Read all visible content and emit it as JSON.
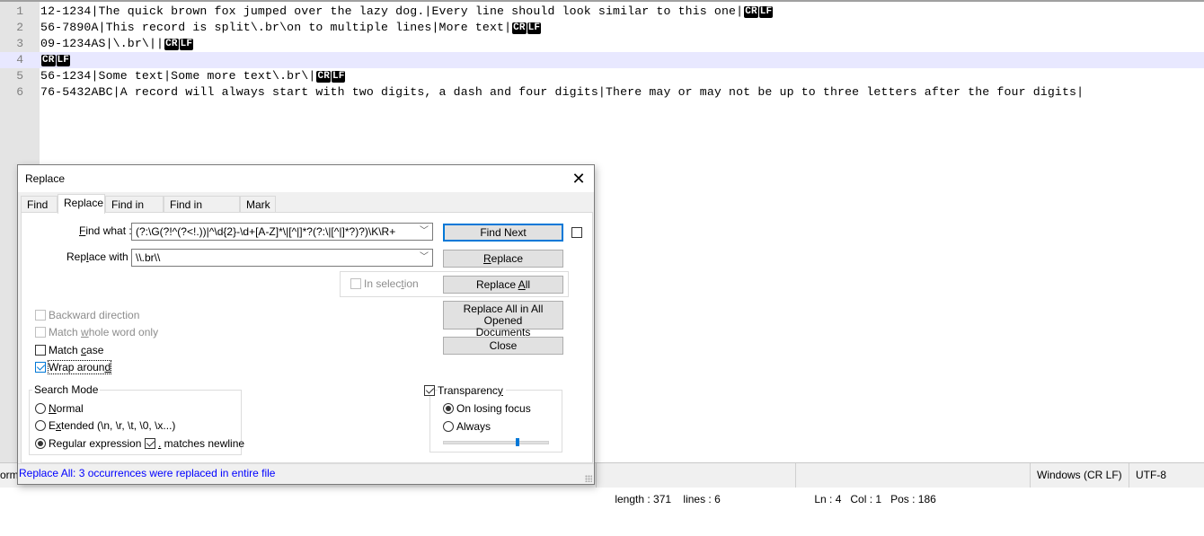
{
  "editor": {
    "current_line": 4,
    "lines": [
      {
        "num": "1",
        "text": "12-1234|The quick brown fox jumped over the lazy dog.|Every line should look similar to this one|",
        "eol": true
      },
      {
        "num": "2",
        "text": "56-7890A|This record is split\\.br\\on to multiple lines|More text|",
        "eol": true
      },
      {
        "num": "3",
        "text": "09-1234AS|\\.br\\||",
        "eol": true
      },
      {
        "num": "4",
        "text": "",
        "eol": true
      },
      {
        "num": "5",
        "text": "56-1234|Some text|Some more text\\.br\\|",
        "eol": true
      },
      {
        "num": "6",
        "text": "76-5432ABC|A record will always start with two digits, a dash and four digits|There may or may not be up to three letters after the four digits|",
        "eol": false
      }
    ],
    "eol_cr": "CR",
    "eol_lf": "LF"
  },
  "statusbar": {
    "left_fragment": "orm",
    "length": "length : 371",
    "lines": "lines : 6",
    "ln": "Ln : 4",
    "col": "Col : 1",
    "pos": "Pos : 186",
    "eol_format": "Windows (CR LF)",
    "encoding": "UTF-8"
  },
  "dialog": {
    "title": "Replace",
    "close_icon": "close-icon",
    "tabs": [
      {
        "label": "Find",
        "active": false
      },
      {
        "label": "Replace",
        "active": true
      },
      {
        "label": "Find in Files",
        "active": false
      },
      {
        "label": "Find in Projects",
        "active": false
      },
      {
        "label": "Mark",
        "active": false
      }
    ],
    "find_what_label": "ind what :",
    "find_what_mnemonic": "F",
    "find_what_value": "(?:\\G(?!^(?<!.))|^\\d{2}-\\d+[A-Z]*\\|[^|]*?(?:\\|[^|]*?)?)\\K\\R+",
    "replace_with_label_pre": "Rep",
    "replace_with_mnemonic": "l",
    "replace_with_label_post": "ace with :",
    "replace_with_value": "\\\\.br\\\\",
    "buttons": {
      "find_next": "Find Next",
      "replace_pre": "",
      "replace_mnemonic": "R",
      "replace_post": "eplace",
      "replace_all_pre": "Replace ",
      "replace_all_mnemonic": "A",
      "replace_all_post": "ll",
      "replace_all_opened_line1": "Replace All in All Opened",
      "replace_all_opened_line2_pre": "Doc",
      "replace_all_opened_line2_mnemonic": "u",
      "replace_all_opened_line2_post": "ments",
      "close": "Close"
    },
    "in_selection_pre": "In selec",
    "in_selection_mnemonic": "t",
    "in_selection_post": "ion",
    "in_selection_checked": false,
    "options": {
      "backward": {
        "label": "Backward direction",
        "checked": false,
        "enabled": false
      },
      "whole_word_pre": "Match ",
      "whole_word_mnemonic": "w",
      "whole_word_post": "hole word only",
      "whole_word": {
        "checked": false,
        "enabled": false
      },
      "match_case_pre": "Match ",
      "match_case_mnemonic": "c",
      "match_case_post": "ase",
      "match_case": {
        "checked": false,
        "enabled": true
      },
      "wrap_pre": "Wrap aroun",
      "wrap_mnemonic": "d",
      "wrap_post": "",
      "wrap_around": {
        "checked": true,
        "enabled": true
      }
    },
    "search_mode": {
      "title": "Search Mode",
      "normal_mnemonic": "N",
      "normal_post": "ormal",
      "extended_pre": "E",
      "extended_mnemonic": "x",
      "extended_post": "tended (\\n, \\r, \\t, \\0, \\x...)",
      "regex_pre": "Re",
      "regex_mnemonic": "g",
      "regex_post": "ular expression",
      "selected": "regex",
      "dot_newline_mnemonic": ".",
      "dot_newline_post": " matches newline",
      "dot_newline_checked": true
    },
    "transparency": {
      "label_pre": "Transparenc",
      "label_mnemonic": "y",
      "checked": true,
      "on_losing_focus": "On losing focus",
      "always": "Always",
      "selected": "on_losing_focus",
      "slider_value_fraction": 0.7
    },
    "status_message": "Replace All: 3 occurrences were replaced in entire file"
  }
}
